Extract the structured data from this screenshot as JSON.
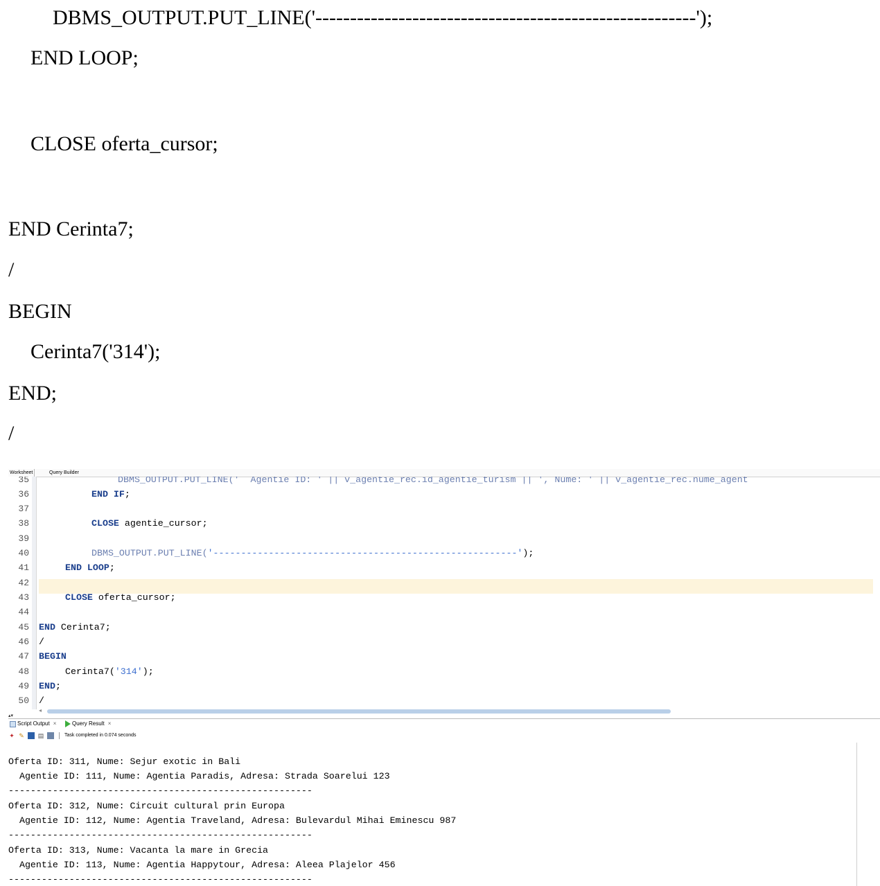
{
  "document": {
    "lines": [
      "DBMS_OUTPUT.PUT_LINE('-------------------------------------------------------');",
      "END LOOP;",
      "CLOSE oferta_cursor;",
      "END Cerinta7;",
      "/",
      "BEGIN",
      "Cerinta7('314');",
      "END;",
      "/"
    ]
  },
  "ide": {
    "tabs": [
      "Worksheet",
      "Query Builder"
    ],
    "editor": {
      "line_numbers": [
        "35",
        "36",
        "37",
        "38",
        "39",
        "40",
        "41",
        "42",
        "43",
        "44",
        "45",
        "46",
        "47",
        "48",
        "49",
        "50"
      ],
      "code": {
        "l35": "DBMS_OUTPUT.PUT_LINE('  Agentie ID: ' || v_agentie_rec.id_agentie_turism || ', Nume: ' || v_agentie_rec.nume_agent",
        "l36_kw": "END IF",
        "l36_rest": ";",
        "l38_kw": "CLOSE",
        "l38_rest": " agentie_cursor;",
        "l40_fn": "DBMS_OUTPUT.PUT_LINE(",
        "l40_str": "'-------------------------------------------------------'",
        "l40_rest": ");",
        "l41_kw": "END LOOP",
        "l41_rest": ";",
        "l43_kw": "CLOSE",
        "l43_rest": " oferta_cursor;",
        "l45_kw": "END",
        "l45_rest": " Cerinta7;",
        "l46": "/",
        "l47_kw": "BEGIN",
        "l48_pre": "Cerinta7(",
        "l48_str": "'314'",
        "l48_rest": ");",
        "l49_kw": "END",
        "l49_rest": ";",
        "l50": "/"
      }
    },
    "output_tabs": {
      "script_output": "Script Output",
      "query_result": "Query Result",
      "close": "×"
    },
    "toolbar": {
      "status": "Task completed in 0.074 seconds"
    },
    "output_lines": [
      "Oferta ID: 311, Nume: Sejur exotic in Bali",
      "  Agentie ID: 111, Nume: Agentia Paradis, Adresa: Strada Soarelui 123",
      "-------------------------------------------------------",
      "Oferta ID: 312, Nume: Circuit cultural prin Europa",
      "  Agentie ID: 112, Nume: Agentia Traveland, Adresa: Bulevardul Mihai Eminescu 987",
      "-------------------------------------------------------",
      "Oferta ID: 313, Nume: Vacanta la mare in Grecia",
      "  Agentie ID: 113, Nume: Agentia Happytour, Adresa: Aleea Plajelor 456",
      "-------------------------------------------------------"
    ]
  }
}
